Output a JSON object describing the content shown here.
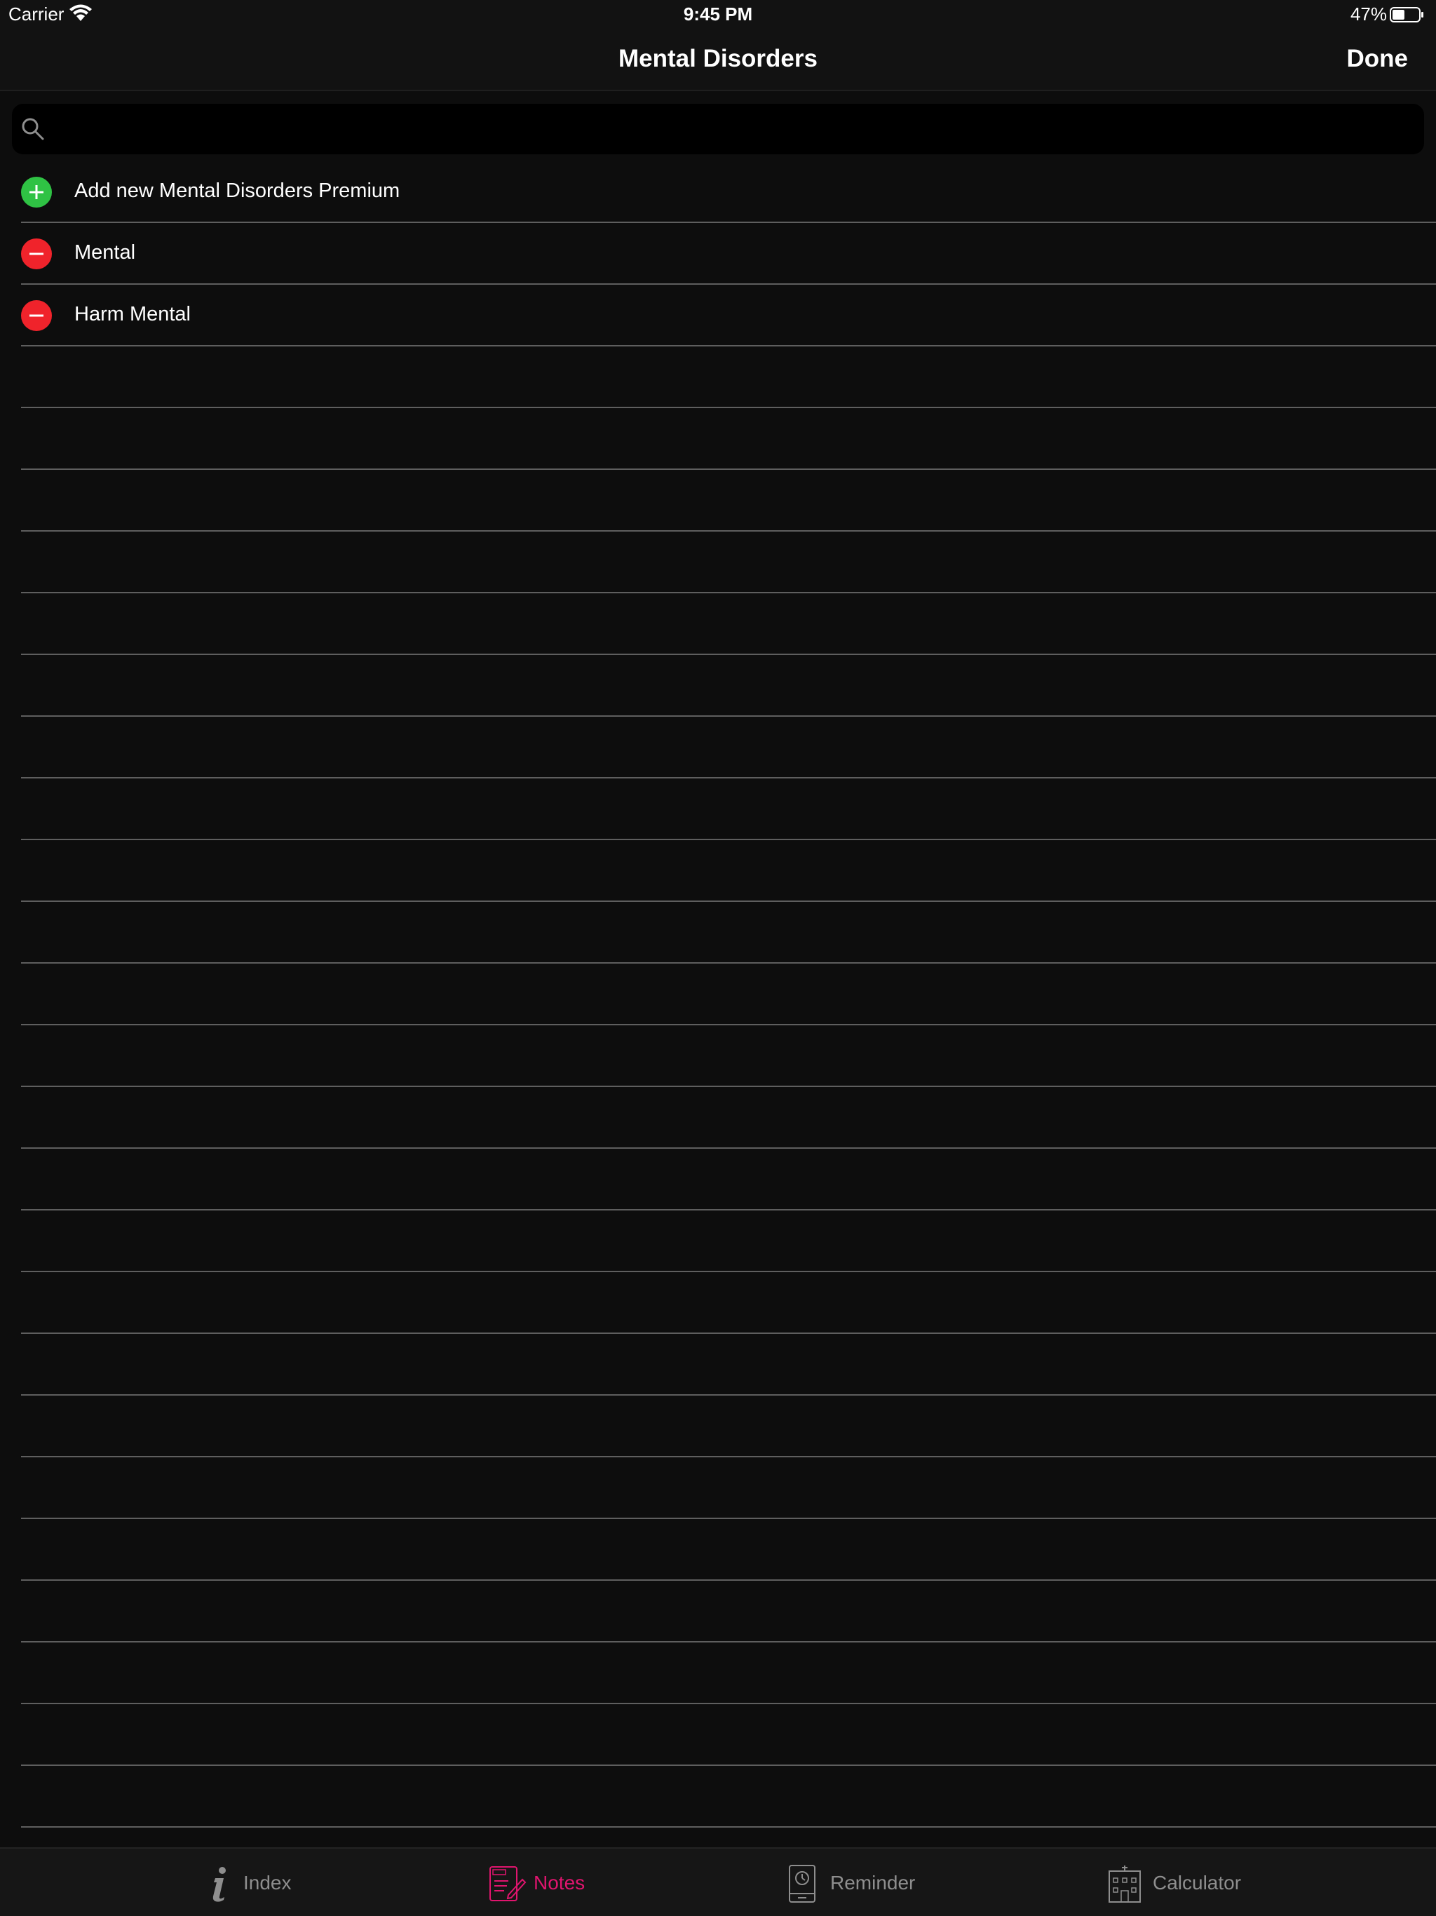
{
  "status_bar": {
    "carrier": "Carrier",
    "time": "9:45 PM",
    "battery": "47%",
    "battery_level": 0.47
  },
  "nav": {
    "title": "Mental Disorders",
    "done_label": "Done"
  },
  "search": {
    "value": "",
    "placeholder": ""
  },
  "list": {
    "add_item": "Add new Mental Disorders Premium",
    "items": [
      {
        "label": "Mental"
      },
      {
        "label": "Harm Mental"
      }
    ]
  },
  "tab_bar": {
    "active_color": "#e0156e",
    "inactive_color": "#8e8e8e",
    "tabs": [
      {
        "label": "Index",
        "icon": "info-icon"
      },
      {
        "label": "Notes",
        "icon": "notes-icon"
      },
      {
        "label": "Reminder",
        "icon": "reminder-icon"
      },
      {
        "label": "Calculator",
        "icon": "calculator-icon"
      }
    ]
  },
  "colors": {
    "background": "#0d0d0d",
    "add": "#2fc244",
    "remove": "#f0232b",
    "separator": "#5e5e5e"
  }
}
